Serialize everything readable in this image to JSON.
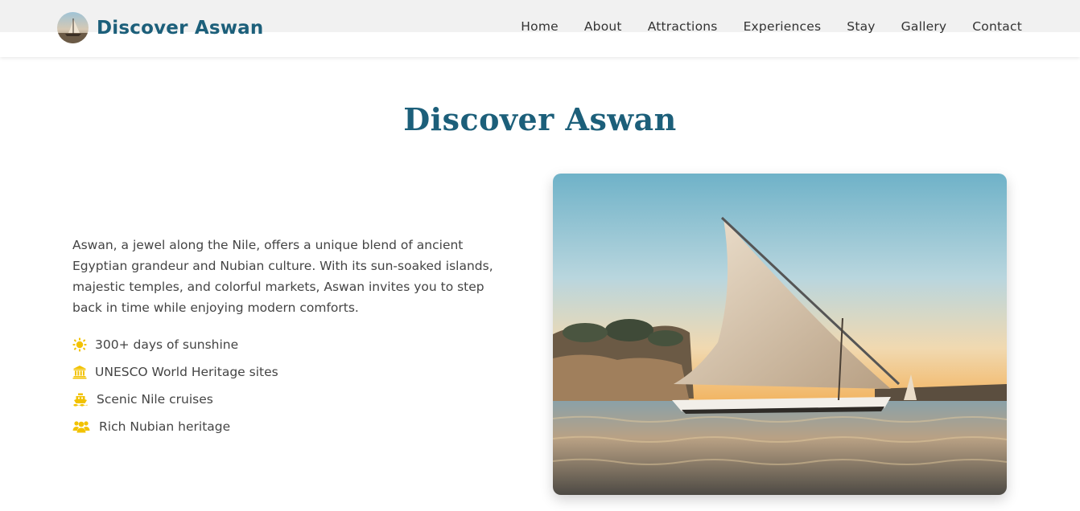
{
  "brand": {
    "name": "Discover Aswan",
    "logo_icon": "felucca-logo-icon"
  },
  "nav": {
    "items": [
      {
        "label": "Home"
      },
      {
        "label": "About"
      },
      {
        "label": "Attractions"
      },
      {
        "label": "Experiences"
      },
      {
        "label": "Stay"
      },
      {
        "label": "Gallery"
      },
      {
        "label": "Contact"
      }
    ]
  },
  "about": {
    "title": "Discover Aswan",
    "description": "Aswan, a jewel along the Nile, offers a unique blend of ancient Egyptian grandeur and Nubian culture. With its sun-soaked islands, majestic temples, and colorful markets, Aswan invites you to step back in time while enjoying modern comforts.",
    "features": [
      {
        "icon": "sun-icon",
        "text": "300+ days of sunshine"
      },
      {
        "icon": "landmark-icon",
        "text": "UNESCO World Heritage sites"
      },
      {
        "icon": "ship-icon",
        "text": "Scenic Nile cruises"
      },
      {
        "icon": "users-icon",
        "text": "Rich Nubian heritage"
      }
    ],
    "image": {
      "subject": "felucca-sailboat-on-nile-image"
    }
  },
  "colors": {
    "brand": "#1c5f7a",
    "accent_icon": "#f2c200",
    "text": "#444444",
    "nav_bg": "#f1f1f1"
  }
}
